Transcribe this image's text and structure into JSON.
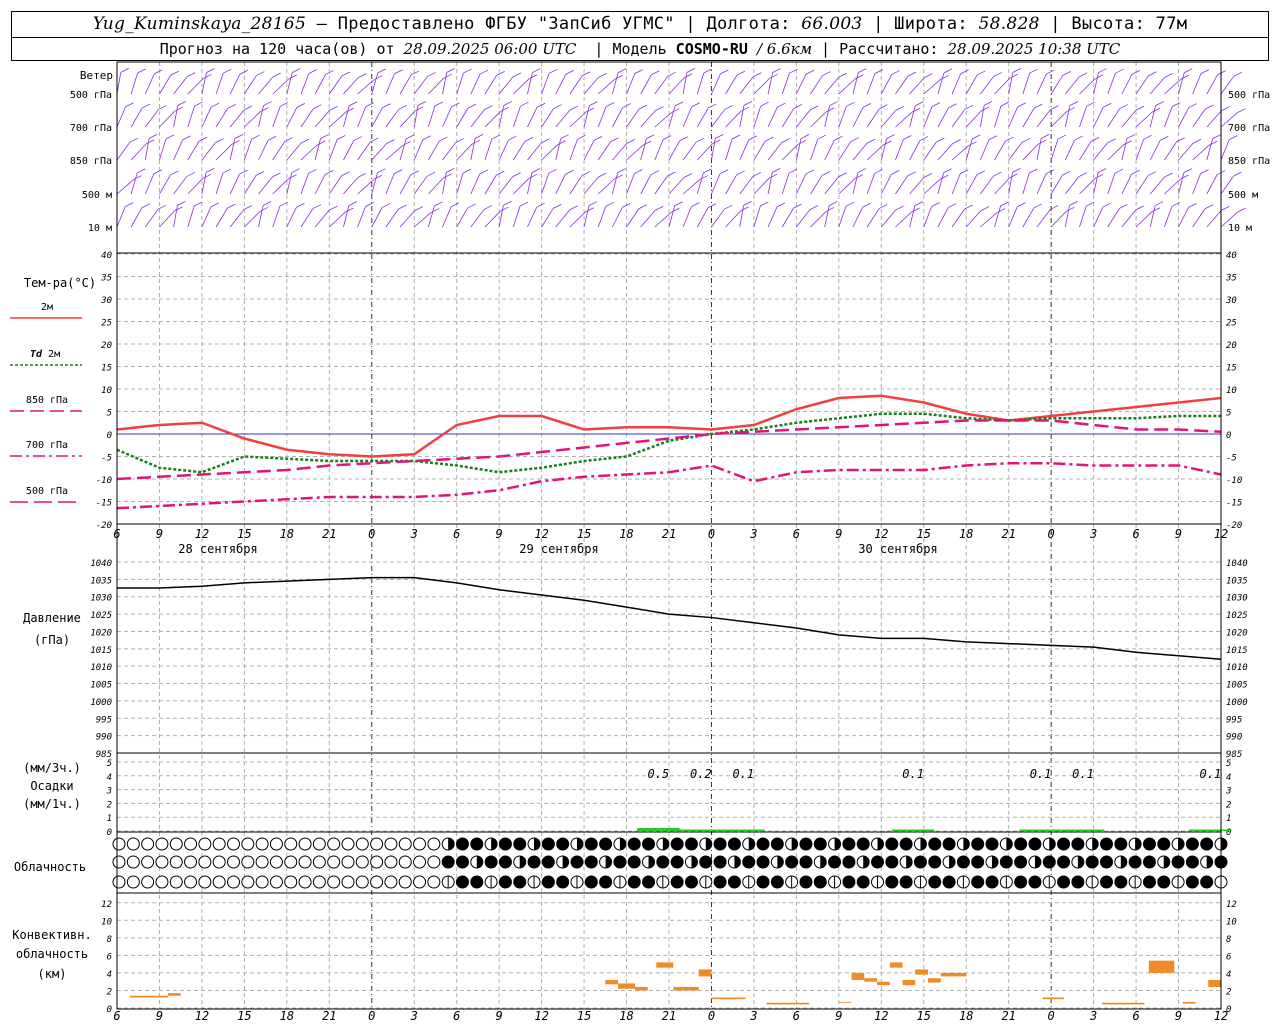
{
  "header": {
    "station": "Yug_Kuminskaya_28165",
    "provider": "Предоставлено ФГБУ \"ЗапСиб УГМС\"",
    "lon_label": "Долгота:",
    "lon": "66.003",
    "lat_label": "Широта:",
    "lat": "58.828",
    "alt_label": "Высота:",
    "alt": "77м",
    "forecast_prefix": "Прогноз на 120 часа(ов) от",
    "forecast_start": "28.09.2025 06:00 UTC",
    "model_label": "Модель",
    "model": "COSMO-RU",
    "resolution": "/ 6.6км",
    "computed_label": "Рассчитано:",
    "computed": "28.09.2025 10:38 UTC",
    "dash": "—"
  },
  "chart_data": [
    {
      "type": "wind-barbs",
      "title": "Ветер",
      "levels": [
        "500 гПа",
        "700 гПа",
        "850 гПа",
        "500 м",
        "10  м"
      ],
      "colors": {
        "barb": "#8b2be2"
      }
    },
    {
      "type": "line",
      "ylabel": "Тем-ра(°C)",
      "ylim": [
        -20,
        40
      ],
      "yticks": [
        40,
        35,
        30,
        25,
        20,
        15,
        10,
        5,
        0,
        -5,
        -10,
        -15,
        -20
      ],
      "x_hours_utc": [
        "6",
        "9",
        "12",
        "15",
        "18",
        "21",
        "0",
        "3",
        "6",
        "9",
        "12",
        "15",
        "18",
        "21",
        "0",
        "3",
        "6",
        "9",
        "12",
        "15",
        "18",
        "21",
        "0",
        "3",
        "6",
        "9",
        "12"
      ],
      "dates": [
        "28 сентября",
        "29 сентября",
        "30 сентября"
      ],
      "series": [
        {
          "name": "2м",
          "color": "#f04040",
          "style": "solid",
          "values": [
            1,
            2,
            2.5,
            -1,
            -3.5,
            -4.5,
            -5,
            -4.5,
            2,
            4,
            4,
            1,
            1.5,
            1.5,
            1,
            2,
            5.5,
            8,
            8.5,
            7,
            4.5,
            3,
            4,
            5,
            6,
            7,
            8
          ]
        },
        {
          "name": "Td 2м",
          "name_prefix": "Td",
          "name_suffix": "2м",
          "color": "#1a7f1a",
          "style": "dotted",
          "values": [
            -3.5,
            -7.5,
            -8.5,
            -5,
            -5.5,
            -6,
            -6,
            -6,
            -7,
            -8.5,
            -7.5,
            -6,
            -5,
            -1.5,
            0,
            1,
            2.5,
            3.5,
            4.5,
            4.5,
            3.5,
            3,
            3.5,
            3.5,
            3.5,
            4,
            4
          ]
        },
        {
          "name": "850 гПа",
          "color": "#e0147a",
          "style": "dash",
          "values": [
            -10,
            -9.5,
            -9,
            -8.5,
            -8,
            -7,
            -6.5,
            -6,
            -5.5,
            -5,
            -4,
            -3,
            -2,
            -1,
            0,
            0.5,
            1,
            1.5,
            2,
            2.5,
            3,
            3,
            3,
            2,
            1,
            1,
            0.5
          ]
        },
        {
          "name": "700 гПа",
          "color": "#e0147a",
          "style": "dashdot",
          "values": [
            -16.5,
            -16,
            -15.5,
            -15,
            -14.5,
            -14,
            -14,
            -14,
            -13.5,
            -12.5,
            -10.5,
            -9.5,
            -9,
            -8.5,
            -7,
            -10.5,
            -8.5,
            -8,
            -8,
            -8,
            -7,
            -6.5,
            -6.5,
            -7,
            -7,
            -7,
            -9
          ]
        },
        {
          "name": "500 гПа",
          "color": "#e0147a",
          "style": "longdash",
          "values": []
        }
      ]
    },
    {
      "type": "line",
      "ylabel": "Давление",
      "unit": "(гПа)",
      "ylim": [
        985,
        1040
      ],
      "yticks": [
        1040,
        1035,
        1030,
        1025,
        1020,
        1015,
        1010,
        1005,
        1000,
        995,
        990,
        985
      ],
      "series": [
        {
          "name": "",
          "color": "#000000",
          "values": [
            1032.5,
            1032.5,
            1033,
            1034,
            1034.5,
            1035,
            1035.5,
            1035.5,
            1034,
            1032,
            1030.5,
            1029,
            1027,
            1025,
            1024,
            1022.5,
            1021,
            1019,
            1018,
            1018,
            1017,
            1016.5,
            1016,
            1015.5,
            1014,
            1013,
            1012
          ]
        }
      ]
    },
    {
      "type": "bar",
      "ylabel_top": "(мм/3ч.)",
      "ylabel_mid": "Осадки",
      "ylabel_bottom": "(мм/1ч.)",
      "ylim": [
        0,
        5
      ],
      "yticks": [
        "5",
        "4",
        "3",
        "2",
        "1",
        "0"
      ],
      "annotations": [
        {
          "hour_index": 12.75,
          "text": "0.5"
        },
        {
          "hour_index": 13.75,
          "text": "0.2"
        },
        {
          "hour_index": 14.75,
          "text": "0.1"
        },
        {
          "hour_index": 18.75,
          "text": "0.1"
        },
        {
          "hour_index": 21.75,
          "text": "0.1"
        },
        {
          "hour_index": 22.75,
          "text": "0.1"
        },
        {
          "hour_index": 25.75,
          "text": "0.1"
        }
      ],
      "color": "#22cc22"
    },
    {
      "type": "cloud-symbols",
      "ylabel": "Облачность",
      "rows": 3
    },
    {
      "type": "bar",
      "ylabel_1": "Конвективн.",
      "ylabel_2": "облачность",
      "ylabel_3": "(км)",
      "ylim": [
        0,
        13
      ],
      "yticks": [
        "12",
        "10",
        "8",
        "6",
        "4",
        "2",
        "0"
      ],
      "color": "#f08c28"
    }
  ]
}
